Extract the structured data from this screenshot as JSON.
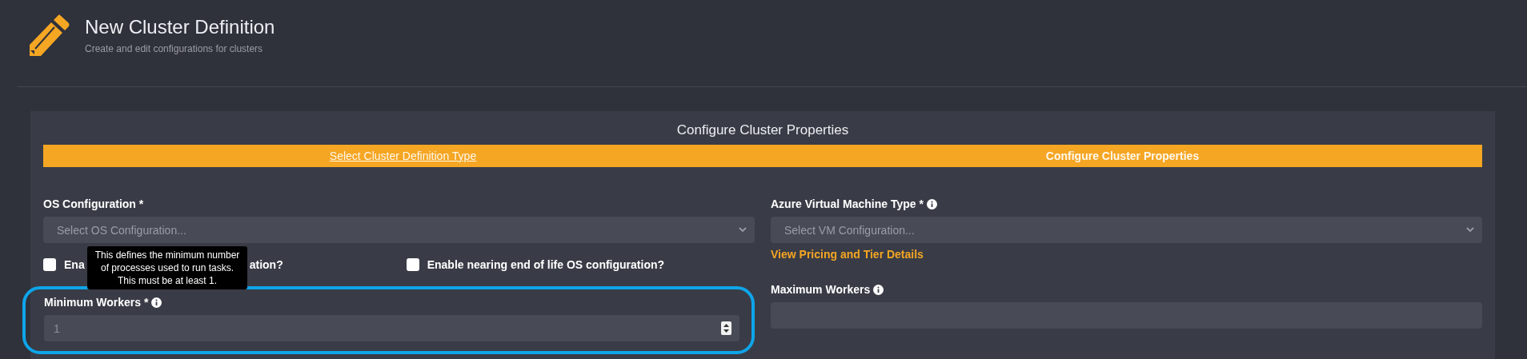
{
  "header": {
    "title": "New Cluster Definition",
    "subtitle": "Create and edit configurations for clusters"
  },
  "panel": {
    "title": "Configure Cluster Properties",
    "steps": [
      {
        "label": "Select Cluster Definition Type",
        "selected": false
      },
      {
        "label": "Configure Cluster Properties",
        "selected": true
      }
    ],
    "os_configuration": {
      "label": "OS Configuration *",
      "placeholder": "Select OS Configuration..."
    },
    "vm_type": {
      "label": "Azure Virtual Machine Type *",
      "placeholder": "Select VM Configuration...",
      "link": "View Pricing and Tier Details"
    },
    "checkboxes": [
      {
        "label_start": "Ena",
        "label_end": "ation?",
        "checked": false
      },
      {
        "label": "Enable nearing end of life OS configuration?",
        "checked": false
      }
    ],
    "tooltip": [
      "This defines the minimum number",
      "of processes used to run tasks.",
      "This must be at least 1."
    ],
    "minimum_workers": {
      "label": "Minimum Workers *",
      "value": "1",
      "highlighted": true
    },
    "maximum_workers": {
      "label": "Maximum Workers"
    }
  }
}
